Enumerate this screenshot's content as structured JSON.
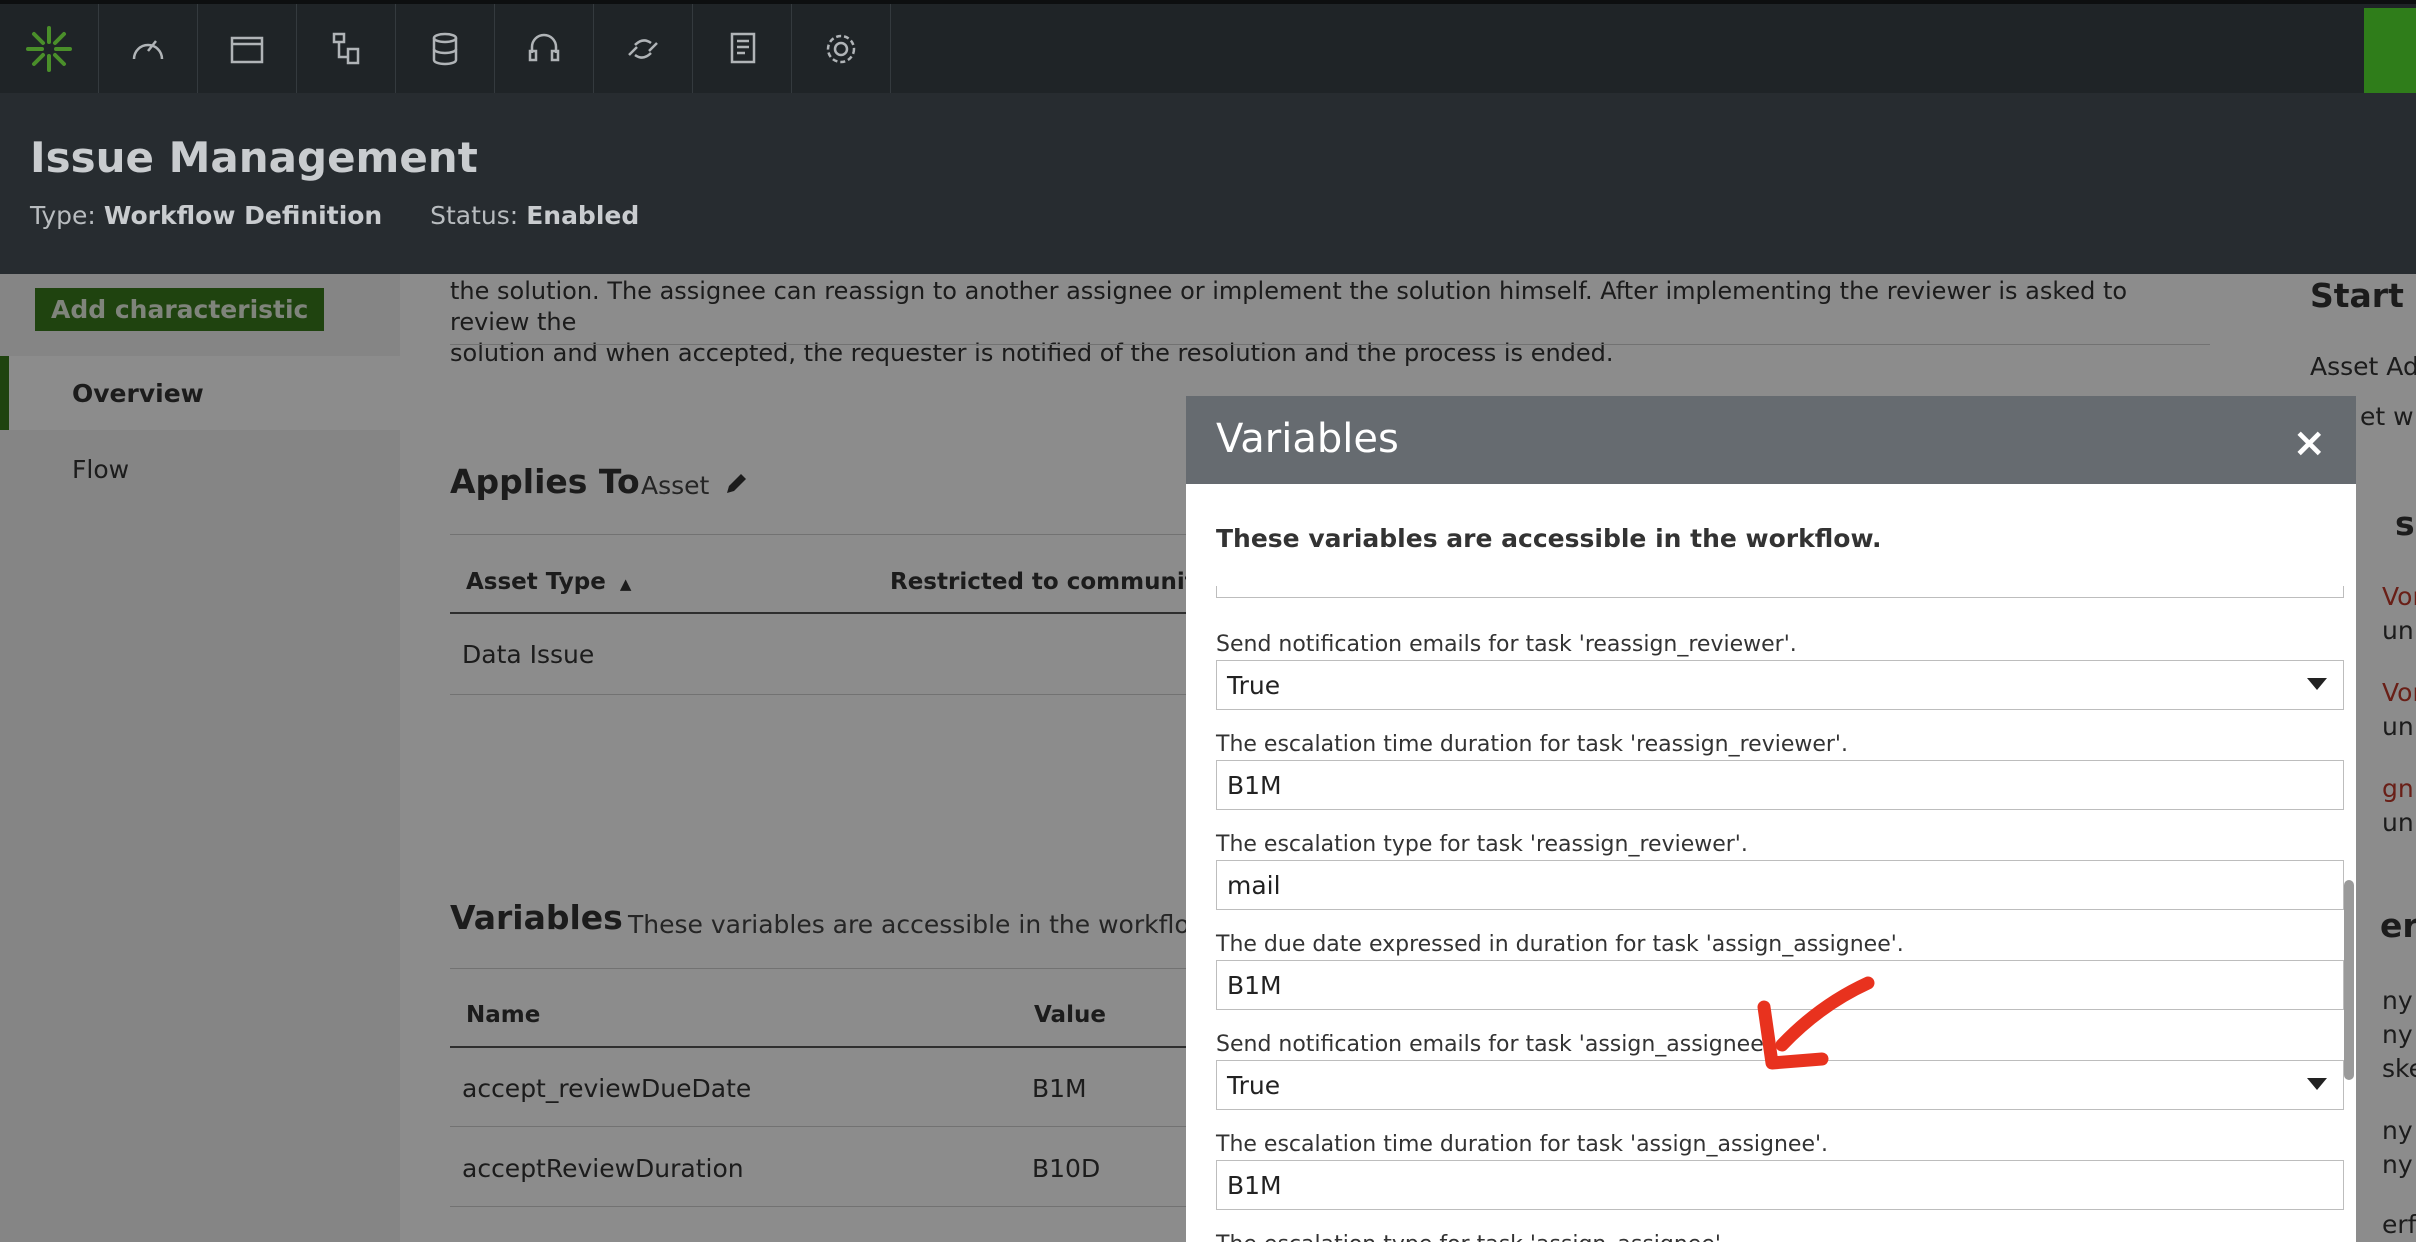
{
  "header": {
    "title": "Issue Management",
    "type_label": "Type:",
    "type_value": "Workflow Definition",
    "status_label": "Status:",
    "status_value": "Enabled"
  },
  "sidebar": {
    "add_button": "Add characteristic",
    "items": [
      {
        "label": "Overview",
        "active": true
      },
      {
        "label": "Flow",
        "active": false
      }
    ]
  },
  "main": {
    "description_line1": "the solution. The assignee can reassign to another assignee or implement the solution himself. After implementing the reviewer is asked to review the",
    "description_line2": "solution and when accepted, the requester is notified of the resolution and the process is ended.",
    "applies_to": {
      "title": "Applies To",
      "value": "Asset",
      "columns": [
        "Asset Type",
        "Restricted to community/d"
      ],
      "rows": [
        [
          "Data Issue"
        ]
      ]
    },
    "variables": {
      "title": "Variables",
      "subtitle": "These variables are accessible in the workflow.",
      "columns": [
        "Name",
        "Value"
      ],
      "rows": [
        {
          "name": "accept_reviewDueDate",
          "value": "B1M"
        },
        {
          "name": "acceptReviewDuration",
          "value": "B10D"
        }
      ]
    }
  },
  "right_column": {
    "fragments": [
      "Start E",
      "Asset Ado",
      "et w",
      "s",
      "Vor",
      "un",
      "Vor",
      "un",
      "gn",
      "un",
      "er",
      "ny",
      "ny",
      "ske",
      "ny",
      "ny",
      "erf"
    ]
  },
  "modal": {
    "title": "Variables",
    "close": "×",
    "intro": "These variables are accessible in the workflow.",
    "fields": [
      {
        "label": "Send notification emails for task 'reassign_reviewer'.",
        "value": "True",
        "type": "select"
      },
      {
        "label": "The escalation time duration for task 'reassign_reviewer'.",
        "value": "B1M",
        "type": "input"
      },
      {
        "label": "The escalation type for task 'reassign_reviewer'.",
        "value": "mail",
        "type": "input"
      },
      {
        "label": "The due date expressed in duration for task 'assign_assignee'.",
        "value": "B1M",
        "type": "input"
      },
      {
        "label": "Send notification emails for task 'assign_assignee'.",
        "value": "True",
        "type": "select"
      },
      {
        "label": "The escalation time duration for task 'assign_assignee'.",
        "value": "B1M",
        "type": "input"
      },
      {
        "label": "The escalation type for task 'assign_assignee'.",
        "value": "",
        "type": "input"
      }
    ]
  },
  "icons": [
    "logo-icon",
    "dashboard-icon",
    "folder-icon",
    "diagram-icon",
    "database-icon",
    "support-icon",
    "transfer-icon",
    "reports-icon",
    "gear-icon",
    "pencil-icon",
    "sort-up-icon",
    "close-icon",
    "arrow-annotation-icon"
  ],
  "colors": {
    "accent": "#3a7a1c",
    "topbar": "#1f2427",
    "header": "#272c30",
    "modal_head": "#666b70",
    "annotation": "#e8321e"
  }
}
